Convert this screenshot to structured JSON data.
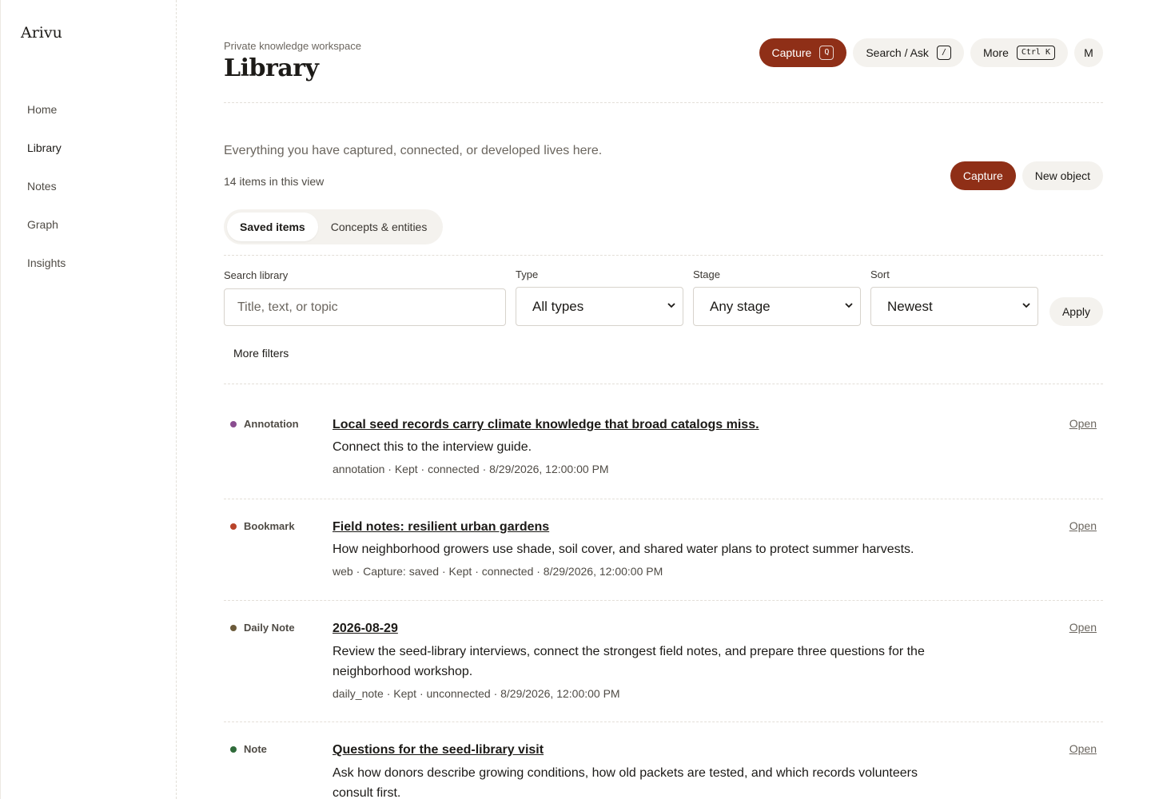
{
  "brand": "Arivu",
  "nav": [
    "Home",
    "Library",
    "Notes",
    "Graph",
    "Insights"
  ],
  "nav_active": "Library",
  "header": {
    "kicker": "Private knowledge workspace",
    "title": "Library",
    "capture_label": "Capture",
    "capture_key": "Q",
    "search_label": "Search / Ask",
    "search_key": "/",
    "more_label": "More",
    "more_key": "Ctrl K",
    "avatar": "M"
  },
  "intro": "Everything you have captured, connected, or developed lives here.",
  "count": "14 items in this view",
  "actions": {
    "capture": "Capture",
    "new_object": "New object"
  },
  "tabs": [
    "Saved items",
    "Concepts & entities"
  ],
  "filters": {
    "search_label": "Search library",
    "search_placeholder": "Title, text, or topic",
    "type_label": "Type",
    "type_value": "All types",
    "stage_label": "Stage",
    "stage_value": "Any stage",
    "sort_label": "Sort",
    "sort_value": "Newest",
    "apply": "Apply",
    "more": "More filters"
  },
  "items": [
    {
      "kind": "Annotation",
      "dot_color": "#8a4d90",
      "title": "Local seed records carry climate knowledge that broad catalogs miss.",
      "desc": "Connect this to the interview guide.",
      "meta": "annotation · Kept · connected · 8/29/2026, 12:00:00 PM",
      "open": "Open"
    },
    {
      "kind": "Bookmark",
      "dot_color": "#b8432a",
      "title": "Field notes: resilient urban gardens",
      "desc": "How neighborhood growers use shade, soil cover, and shared water plans to protect summer harvests.",
      "meta": "web · Capture: saved · Kept · connected · 8/29/2026, 12:00:00 PM",
      "open": "Open"
    },
    {
      "kind": "Daily Note",
      "dot_color": "#6b5a3a",
      "title": "2026-08-29",
      "desc": "Review the seed-library interviews, connect the strongest field notes, and prepare three questions for the neighborhood workshop.",
      "meta": "daily_note · Kept · unconnected · 8/29/2026, 12:00:00 PM",
      "open": "Open"
    },
    {
      "kind": "Note",
      "dot_color": "#2f6b3a",
      "title": "Questions for the seed-library visit",
      "desc": "Ask how donors describe growing conditions, how old packets are tested, and which records volunteers consult first.",
      "meta": "",
      "open": "Open"
    }
  ],
  "colors": {
    "accent": "#8f2f17",
    "pill_bg": "#f4f2ee"
  }
}
